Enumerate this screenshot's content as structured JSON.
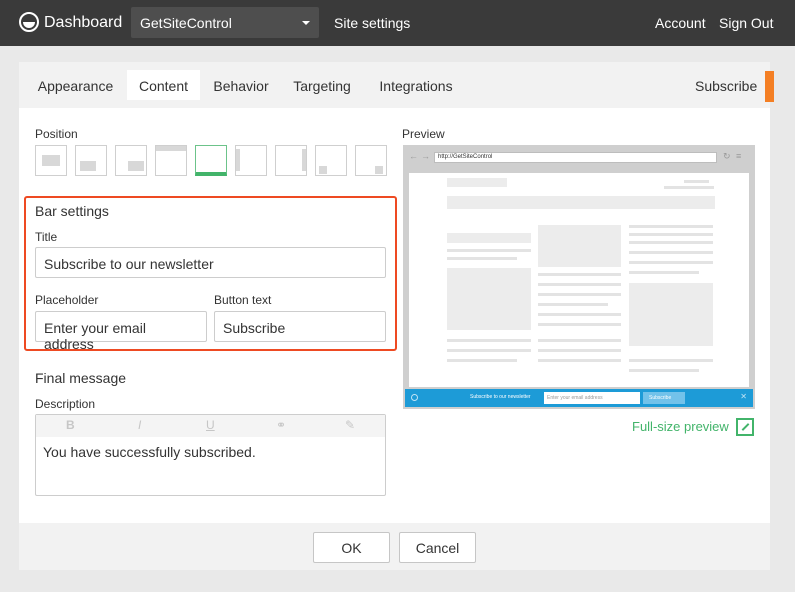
{
  "topbar": {
    "brand": "Dashboard",
    "site_selector": "GetSiteControl",
    "site_settings": "Site settings",
    "account": "Account",
    "sign_out": "Sign Out"
  },
  "tabs": [
    {
      "label": "Appearance",
      "active": false
    },
    {
      "label": "Content",
      "active": true
    },
    {
      "label": "Behavior",
      "active": false
    },
    {
      "label": "Targeting",
      "active": false
    },
    {
      "label": "Integrations",
      "active": false
    }
  ],
  "widget_type": "Subscribe",
  "position": {
    "label": "Position",
    "selected_index": 4,
    "option_count": 9
  },
  "bar_settings": {
    "heading": "Bar settings",
    "title_label": "Title",
    "title_value": "Subscribe to our newsletter",
    "placeholder_label": "Placeholder",
    "placeholder_value": "Enter your email address",
    "button_text_label": "Button text",
    "button_text_value": "Subscribe"
  },
  "final_message": {
    "heading": "Final message",
    "description_label": "Description",
    "toolbar": [
      "B",
      "I",
      "U",
      "link",
      "clear"
    ],
    "text": "You have successfully subscribed."
  },
  "preview": {
    "label": "Preview",
    "url": "http://GetSiteControl",
    "bar_title": "Subscribe to our newsletter",
    "bar_placeholder": "Enter your email address",
    "bar_button": "Subscribe",
    "bar_color": "#1d9bd7",
    "full_size": "Full-size preview"
  },
  "footer": {
    "ok": "OK",
    "cancel": "Cancel"
  },
  "colors": {
    "accent_green": "#42b46a",
    "highlight_orange": "#ee4a22",
    "flag_orange": "#f47f24"
  }
}
